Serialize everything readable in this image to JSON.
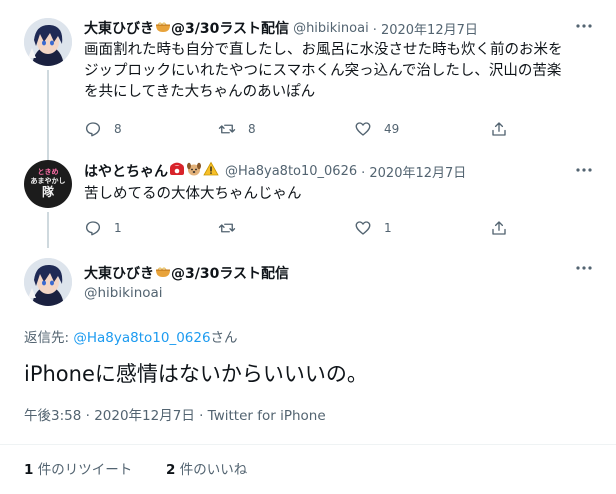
{
  "tweets": [
    {
      "display_name": "大東ひびき",
      "name_suffix": "@3/30ラスト配信",
      "handle": "@hibikinoai",
      "date": "· 2020年12月7日",
      "text_lines": [
        "画面割れた時も自分で直したし、お風呂に水没させた時も炊く前のお米を",
        "ジップロックにいれたやつにスマホくん突っ込んで治したし、沢山の苦楽",
        "を共にしてきた大ちゃんのあいぽん"
      ],
      "replies": "8",
      "retweets": "8",
      "likes": "49"
    },
    {
      "display_name": "はやとちゃん",
      "handle": "@Ha8ya8to10_0626",
      "date": "· 2020年12月7日",
      "text": "苦しめてるの大体大ちゃんじゃん",
      "avatar_text": [
        "ときめ",
        "あまやかし",
        "隊"
      ],
      "replies": "1",
      "retweets": "",
      "likes": "1"
    }
  ],
  "main_tweet": {
    "display_name": "大東ひびき",
    "name_suffix": "@3/30ラスト配信",
    "handle": "@hibikinoai",
    "reply_to_prefix": "返信先: ",
    "reply_to_handle": "@Ha8ya8to10_0626",
    "reply_to_suffix": "さん",
    "text": "iPhoneに感情はないからいいいの。",
    "timestamp": "午後3:58 · 2020年12月7日 · Twitter for iPhone",
    "retweet_count": "1",
    "retweet_label": " 件のリツイート",
    "like_count": "2",
    "like_label": " 件のいいね"
  },
  "icons": [
    "reply-icon",
    "retweet-icon",
    "like-icon",
    "share-icon",
    "more-icon",
    "ramen-emoji",
    "telephone-emoji",
    "dog-emoji",
    "warning-emoji"
  ],
  "colors": {
    "accent": "#1d9bf0",
    "secondary_text": "#536471",
    "divider": "#eff3f4",
    "thread_line": "#cfd9de"
  }
}
